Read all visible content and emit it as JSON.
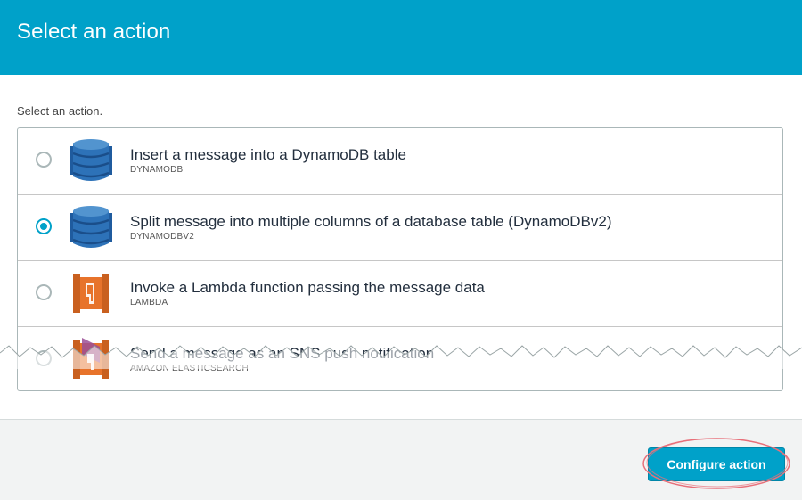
{
  "header": {
    "title": "Select an action"
  },
  "instruction": "Select an action.",
  "actions": [
    {
      "title": "Insert a message into a DynamoDB table",
      "subtitle": "DYNAMODB",
      "icon": "dynamodb-icon",
      "selected": false
    },
    {
      "title": "Split message into multiple columns of a database table (DynamoDBv2)",
      "subtitle": "DYNAMODBV2",
      "icon": "dynamodb-icon",
      "selected": true
    },
    {
      "title": "Invoke a Lambda function passing the message data",
      "subtitle": "LAMBDA",
      "icon": "lambda-icon",
      "selected": false
    },
    {
      "title": "Send a message as an SNS push notification",
      "subtitle": "AMAZON ELASTICSEARCH",
      "icon": "lambda-icon",
      "selected": false
    }
  ],
  "footer": {
    "configure_label": "Configure action"
  },
  "colors": {
    "header": "#00a1c9",
    "accent": "#00a1c9",
    "dynamodb": "#2d72b8",
    "lambda": "#e7732b",
    "annotation": "#e8707a"
  }
}
